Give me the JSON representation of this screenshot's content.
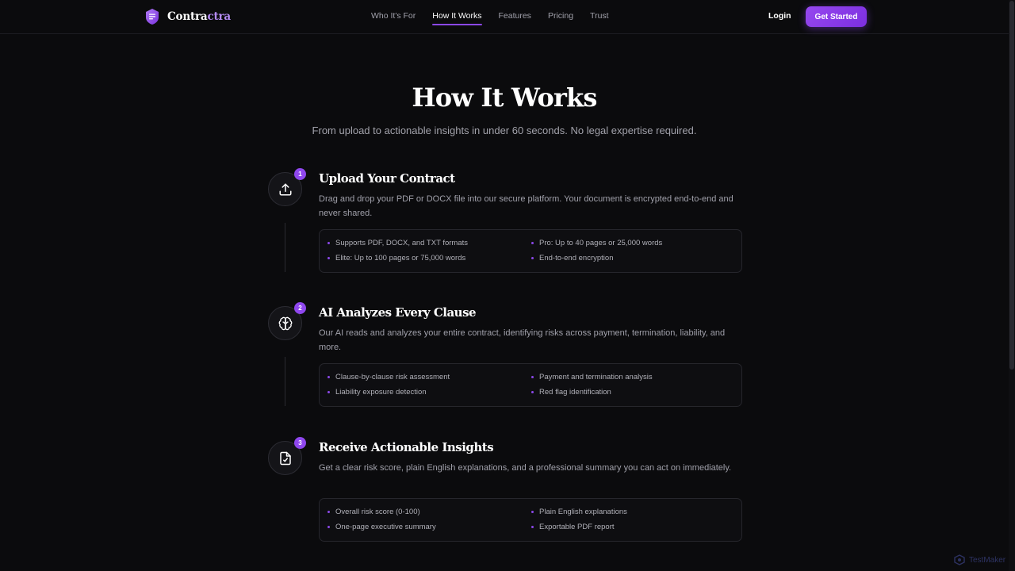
{
  "nav": {
    "logo_part1": "Contra",
    "logo_part2": "ctra",
    "links": [
      {
        "label": "Who It's For",
        "active": false
      },
      {
        "label": "How It Works",
        "active": true
      },
      {
        "label": "Features",
        "active": false
      },
      {
        "label": "Pricing",
        "active": false
      },
      {
        "label": "Trust",
        "active": false
      }
    ],
    "login": "Login",
    "cta": "Get Started"
  },
  "hero": {
    "title": "How It Works",
    "subtitle": "From upload to actionable insights in under 60 seconds. No legal expertise required."
  },
  "steps": [
    {
      "number": "1",
      "icon": "upload-icon",
      "title": "Upload Your Contract",
      "description": "Drag and drop your PDF or DOCX file into our secure platform. Your document is encrypted end-to-end and never shared.",
      "features": [
        "Supports PDF, DOCX, and TXT formats",
        "Pro: Up to 40 pages or 25,000 words",
        "Elite: Up to 100 pages or 75,000 words",
        "End-to-end encryption"
      ]
    },
    {
      "number": "2",
      "icon": "brain-icon",
      "title": "AI Analyzes Every Clause",
      "description": "Our AI reads and analyzes your entire contract, identifying risks across payment, termination, liability, and more.",
      "features": [
        "Clause-by-clause risk assessment",
        "Payment and termination analysis",
        "Liability exposure detection",
        "Red flag identification"
      ]
    },
    {
      "number": "3",
      "icon": "file-check-icon",
      "title": "Receive Actionable Insights",
      "description": "Get a clear risk score, plain English explanations, and a professional summary you can act on immediately.",
      "features": [
        "Overall risk score (0-100)",
        "Plain English explanations",
        "One-page executive summary",
        "Exportable PDF report"
      ]
    }
  ],
  "watermark": {
    "text": "TestMaker"
  },
  "colors": {
    "accent": "#8f47ee",
    "background": "#0b0b0d"
  }
}
